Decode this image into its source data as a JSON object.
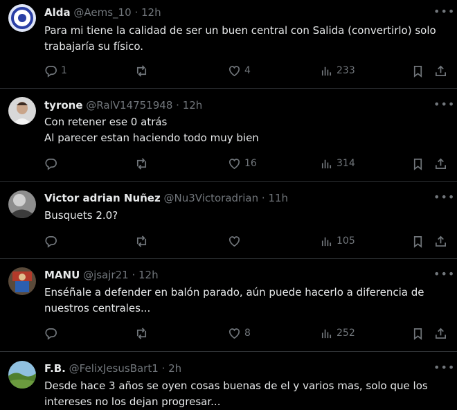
{
  "tweets": [
    {
      "name": "Alda",
      "handle": "@Aems_10",
      "time": "12h",
      "lines": [
        "Para mi tiene la calidad de ser un buen central con Salida (convertirlo) solo",
        "trabajaría su físico."
      ],
      "replies": "1",
      "retweets": "",
      "likes": "4",
      "views": "233",
      "avatar_colors": [
        "#dfe6f7",
        "#2a3fa5"
      ]
    },
    {
      "name": "tyrone",
      "handle": "@RalV14751948",
      "time": "12h",
      "lines": [
        "Con retener ese 0  atrás",
        "Al parecer estan haciendo todo muy bien"
      ],
      "replies": "",
      "retweets": "",
      "likes": "16",
      "views": "314",
      "avatar_colors": [
        "#e8e8e8",
        "#3a2a22"
      ]
    },
    {
      "name": "Victor adrian Nuñez",
      "handle": "@Nu3Victoradrian",
      "time": "11h",
      "lines": [
        "Busquets 2.0?"
      ],
      "replies": "",
      "retweets": "",
      "likes": "",
      "views": "105",
      "avatar_colors": [
        "#9a9a9a",
        "#3c3c3c"
      ]
    },
    {
      "name": "MANU",
      "handle": "@jsajr21",
      "time": "12h",
      "lines": [
        "Enséñale a defender en balón parado, aún puede hacerlo a diferencia de",
        "nuestros centrales..."
      ],
      "replies": "",
      "retweets": "",
      "likes": "8",
      "views": "252",
      "avatar_colors": [
        "#b23a2a",
        "#2c5fb0"
      ]
    },
    {
      "name": "F.B.",
      "handle": "@FelixJesusBart1",
      "time": "2h",
      "lines": [
        "Desde hace 3 años se oyen cosas buenas de el y varios mas, solo que los",
        "intereses no los dejan progresar..."
      ],
      "replies": "",
      "retweets": "",
      "likes": "",
      "views": "",
      "avatar_colors": [
        "#8fc0e0",
        "#4f7f2e"
      ]
    }
  ],
  "separator": "·",
  "more_glyph": "•••",
  "colors": {
    "background": "#000000",
    "text": "#e7e9ea",
    "muted": "#71767b",
    "border": "#2f3336"
  }
}
